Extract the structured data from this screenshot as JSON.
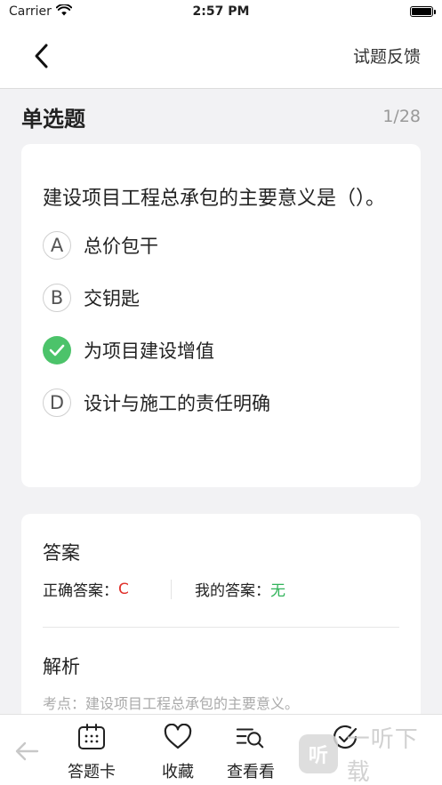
{
  "status_bar": {
    "carrier": "Carrier",
    "time": "2:57 PM",
    "icons": [
      "wifi-icon",
      "battery-icon"
    ]
  },
  "nav": {
    "back_icon": "chevron-left-icon",
    "feedback_label": "试题反馈"
  },
  "section": {
    "title": "单选题",
    "progress": "1/28"
  },
  "question": {
    "text": "建设项目工程总承包的主要意义是（）。",
    "options": [
      {
        "letter": "A",
        "text": "总价包干",
        "selected": false
      },
      {
        "letter": "B",
        "text": "交钥匙",
        "selected": false
      },
      {
        "letter": "C",
        "text": "为项目建设增值",
        "selected": true
      },
      {
        "letter": "D",
        "text": "设计与施工的责任明确",
        "selected": false
      }
    ]
  },
  "answer": {
    "title": "答案",
    "correct_label": "正确答案：",
    "correct_value": "C",
    "mine_label": "我的答案：",
    "mine_value": "无",
    "analysis_title": "解析",
    "analysis_text": "考点：建设项目工程总承包的主要意义。"
  },
  "toolbar": {
    "items": [
      {
        "label": "答题卡",
        "icon": "answer-card-icon"
      },
      {
        "label": "收藏",
        "icon": "heart-icon"
      },
      {
        "label": "查看看",
        "icon": "view-analysis-icon"
      },
      {
        "label": "",
        "icon": "check-circle-icon"
      }
    ],
    "prev_icon": "arrow-left-icon"
  },
  "watermark": {
    "logo_text": "听",
    "text": "一听下载"
  },
  "colors": {
    "correct": "#e0302a",
    "mine": "#31b35a",
    "selected_option": "#4cc36a",
    "background": "#f2f2f4"
  }
}
